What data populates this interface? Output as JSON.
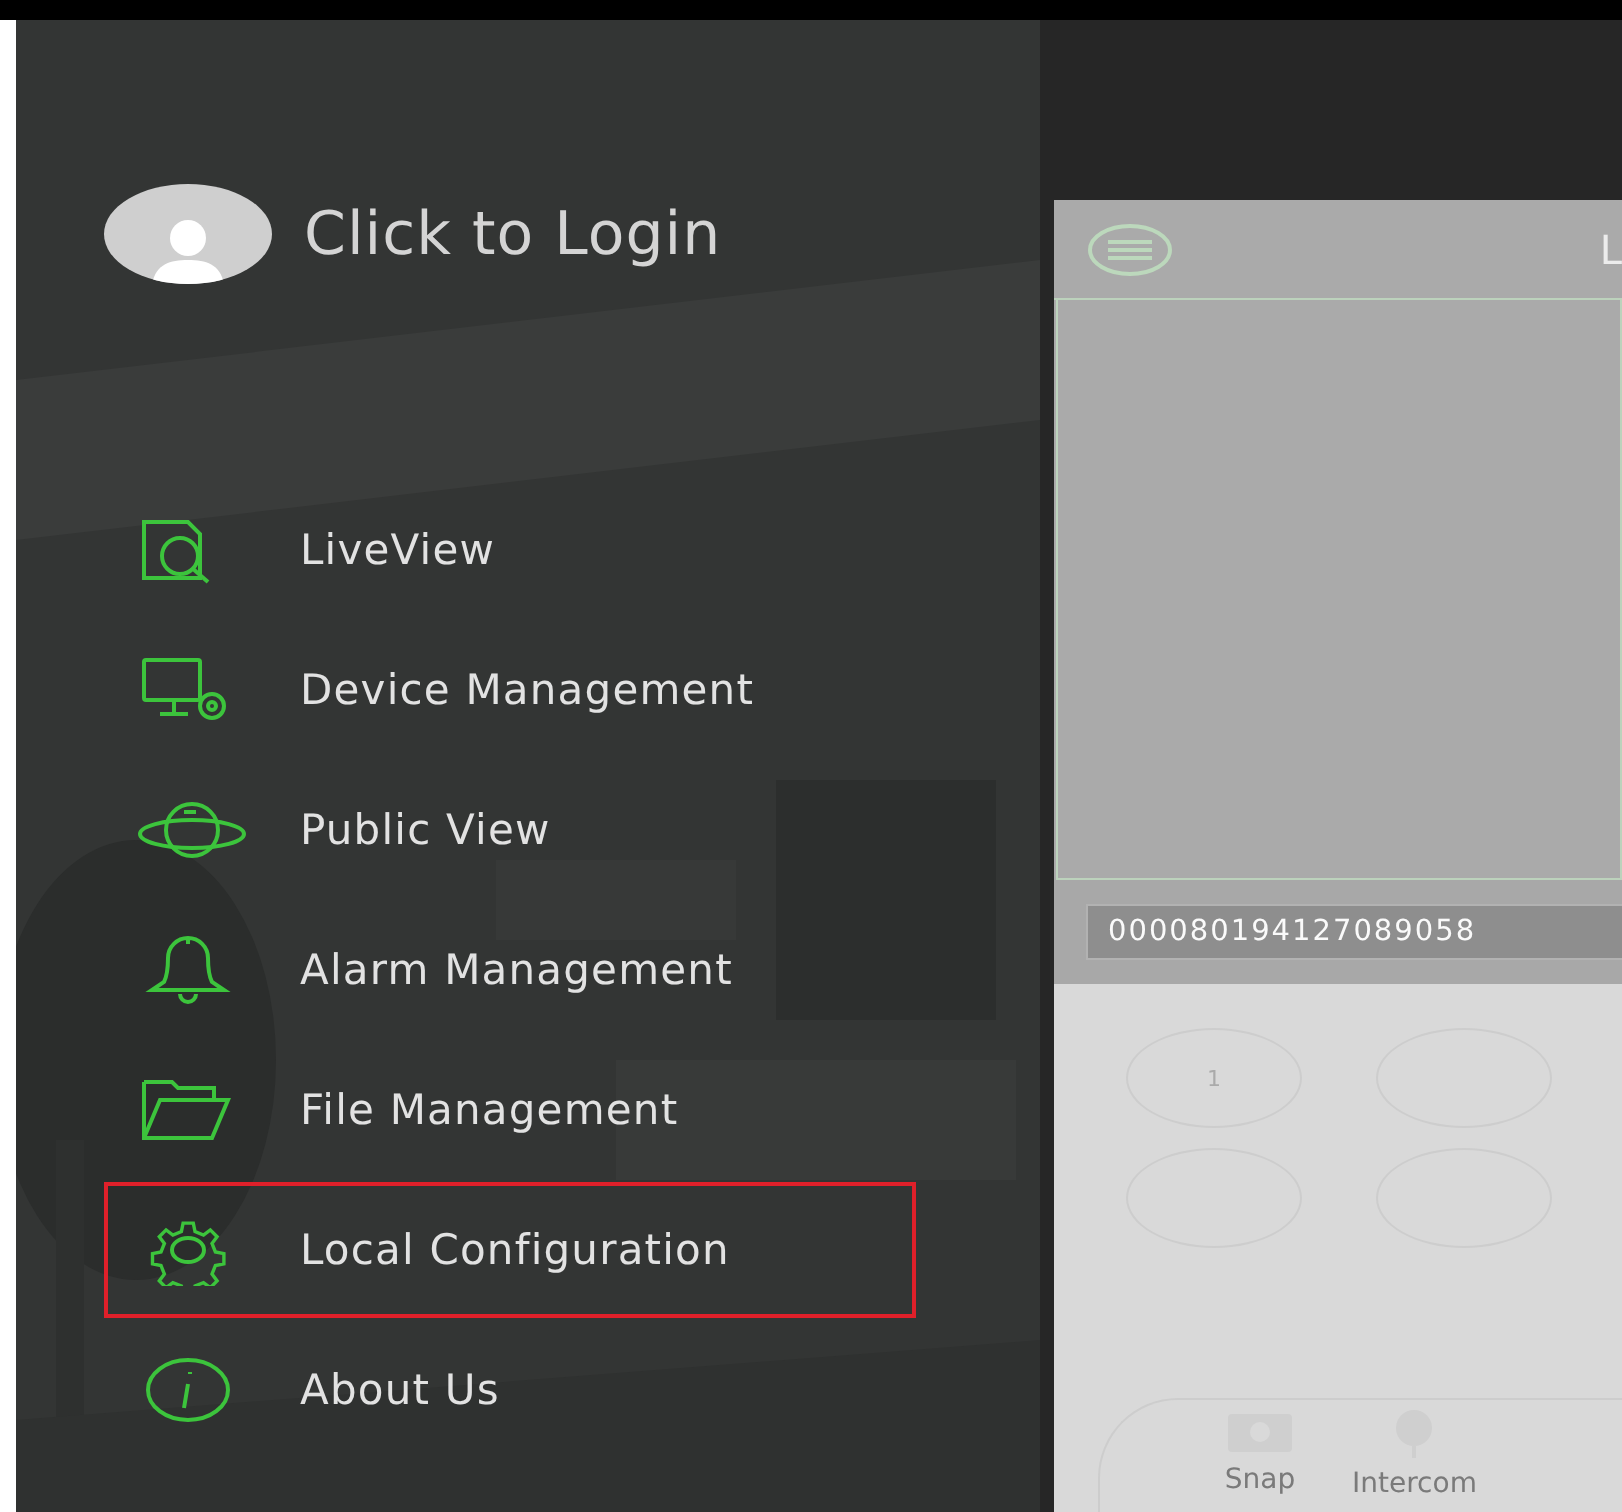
{
  "login": {
    "label": "Click to Login"
  },
  "menu": [
    {
      "label": "LiveView",
      "highlighted": false
    },
    {
      "label": "Device Management",
      "highlighted": false
    },
    {
      "label": "Public View",
      "highlighted": false
    },
    {
      "label": "Alarm Management",
      "highlighted": false
    },
    {
      "label": "File Management",
      "highlighted": false
    },
    {
      "label": "Local Configuration",
      "highlighted": true
    },
    {
      "label": "About Us",
      "highlighted": false
    }
  ],
  "live_panel": {
    "title": "L",
    "device_id": "000080194127089058",
    "keypad": [
      {
        "kind": "digit",
        "label": "1"
      },
      {
        "kind": "blank"
      },
      {
        "kind": "blank"
      },
      {
        "kind": "blank"
      }
    ],
    "toolbar": [
      {
        "label": "Snap"
      },
      {
        "label": "Intercom"
      }
    ]
  }
}
